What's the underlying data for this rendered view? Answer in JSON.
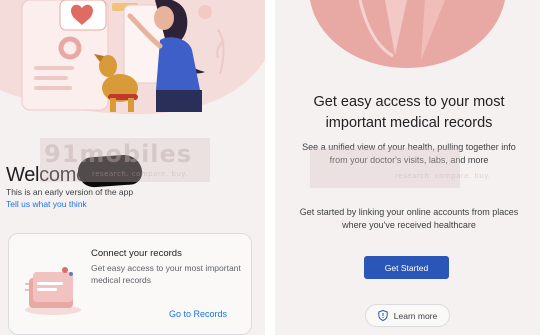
{
  "left_screen": {
    "welcome": "Welcome,",
    "early_notice": "This is an early version of the app",
    "feedback_link": "Tell us what you think",
    "card": {
      "title": "Connect your records",
      "body": "Get easy access to your most important medical records",
      "action": "Go to Records"
    }
  },
  "right_screen": {
    "headline": "Get easy access to your most important medical records",
    "description": "See a unified view of your health, pulling together info from your doctor's visits, labs, and more",
    "instruction": "Get started by linking your online accounts from places where you've received healthcare",
    "primary_button": "Get Started",
    "secondary_button": "Learn more",
    "secondary_button_icon": "shield-icon"
  },
  "watermark": {
    "brand": "91mobiles",
    "tagline": "research. compare. buy."
  },
  "colors": {
    "background": "#f6f1f1",
    "accent_blue": "#1a73e8",
    "button_blue": "#2a56b8",
    "illustration_pink": "#e8a9a5",
    "dog": "#d99a3a",
    "shirt": "#3f5fc8"
  }
}
